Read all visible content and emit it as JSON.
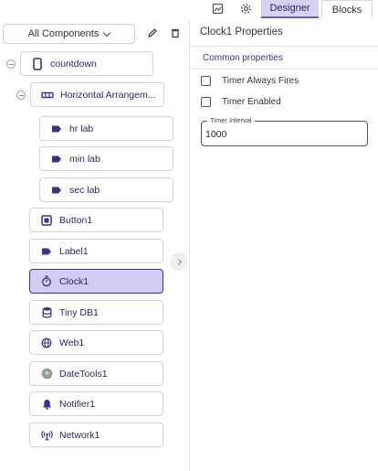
{
  "tabs": [
    {
      "label": "Designer",
      "active": true
    },
    {
      "label": "Blocks",
      "active": false
    }
  ],
  "toolbar_icons": [
    "project-properties-icon",
    "settings-gear-icon"
  ],
  "tree": {
    "filter_label": "All Components",
    "tool_icons": [
      "edit-pencil-icon",
      "delete-trash-icon"
    ],
    "nodes": [
      {
        "label": "countdown",
        "icon": "phone-screen-icon",
        "selected": false
      },
      {
        "label": "Horizontal Arrangem...",
        "icon": "horizontal-arrangement-icon",
        "selected": false
      },
      {
        "label": "hr lab",
        "icon": "label-tag-icon",
        "selected": false
      },
      {
        "label": "min lab",
        "icon": "label-tag-icon",
        "selected": false
      },
      {
        "label": "sec lab",
        "icon": "label-tag-icon",
        "selected": false
      },
      {
        "label": "Button1",
        "icon": "button-icon",
        "selected": false
      },
      {
        "label": "Label1",
        "icon": "label-tag-icon",
        "selected": false
      },
      {
        "label": "Clock1",
        "icon": "stopwatch-icon",
        "selected": true
      },
      {
        "label": "Tiny DB1",
        "icon": "database-icon",
        "selected": false
      },
      {
        "label": "Web1",
        "icon": "globe-icon",
        "selected": false
      },
      {
        "label": "DateTools1",
        "icon": "datetools-icon",
        "selected": false
      },
      {
        "label": "Notifier1",
        "icon": "bell-icon",
        "selected": false
      },
      {
        "label": "Network1",
        "icon": "network-icon",
        "selected": false
      }
    ]
  },
  "properties": {
    "title": "Clock1 Properties",
    "section": "Common properties",
    "checkboxes": [
      {
        "label": "Timer Always Fires",
        "checked": false
      },
      {
        "label": "Timer Enabled",
        "checked": false
      }
    ],
    "timer_interval": {
      "label": "Timer Interval",
      "value": "1000"
    }
  },
  "colors": {
    "accent": "#d4cbf2",
    "accent_border": "#3e2f8e",
    "icon_purple": "#3e2f8e"
  }
}
